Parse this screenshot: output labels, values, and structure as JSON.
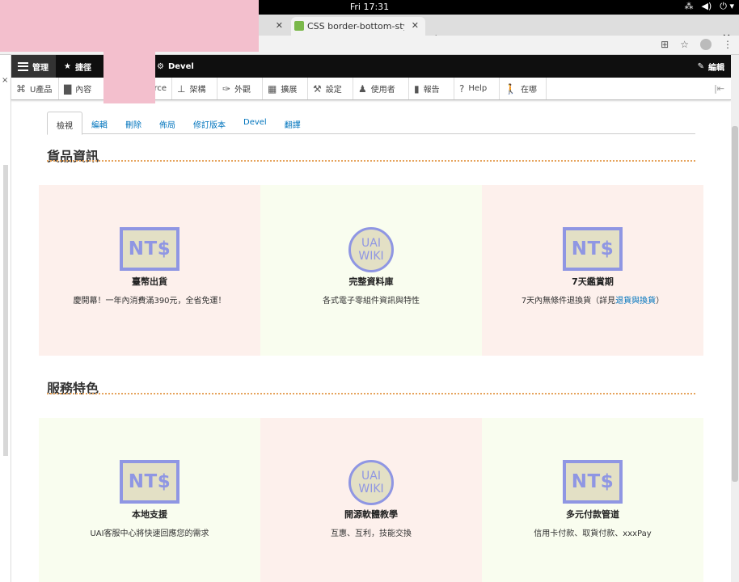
{
  "os": {
    "clock": "Fri 17:31"
  },
  "browser": {
    "tabs": [
      {
        "label": ""
      },
      {
        "label": "CSS border-bottom-style"
      }
    ],
    "new_tab": "+",
    "close": "✕"
  },
  "toolbar": {
    "manage": "管理",
    "shortcuts": "捷徑",
    "devel": "Devel",
    "edit": "編輯"
  },
  "tray": {
    "items": [
      {
        "label": "U產品",
        "icon": "gift-icon"
      },
      {
        "label": "內容",
        "icon": "page-icon"
      },
      {
        "label": "rce",
        "icon": "commerce-icon"
      },
      {
        "label": "架構",
        "icon": "sitemap-icon"
      },
      {
        "label": "外觀",
        "icon": "brush-icon"
      },
      {
        "label": "擴展",
        "icon": "puzzle-icon"
      },
      {
        "label": "設定",
        "icon": "wrench-icon"
      },
      {
        "label": "使用者",
        "icon": "people-icon"
      },
      {
        "label": "報告",
        "icon": "bar-chart-icon"
      },
      {
        "label": "Help",
        "icon": "help-icon"
      },
      {
        "label": "在哪",
        "icon": "walking-icon"
      }
    ]
  },
  "content_tabs": [
    "檢視",
    "編輯",
    "刪除",
    "佈局",
    "修訂版本",
    "Devel",
    "翻譯"
  ],
  "sections": [
    {
      "heading": "貨品資訊",
      "cards": [
        {
          "icon": "ntd",
          "title": "臺幣出貨",
          "desc": "慶開幕！一年內消費滿390元，全省免運！",
          "desc_link": "",
          "desc_tail": ""
        },
        {
          "icon": "wiki",
          "title": "完整資料庫",
          "desc": "各式電子零組件資訊與特性",
          "desc_link": "",
          "desc_tail": ""
        },
        {
          "icon": "ntd",
          "title": "7天鑑賞期",
          "desc": "7天內無條件退換貨（詳見",
          "desc_link": "退貨與換貨",
          "desc_tail": "）"
        }
      ]
    },
    {
      "heading": "服務特色",
      "cards": [
        {
          "icon": "ntd",
          "title": "本地支援",
          "desc": "UAI客服中心將快速回應您的需求",
          "desc_link": "",
          "desc_tail": ""
        },
        {
          "icon": "wiki",
          "title": "開源軟體教學",
          "desc": "互惠、互利，技能交換",
          "desc_link": "",
          "desc_tail": ""
        },
        {
          "icon": "ntd",
          "title": "多元付款管道",
          "desc": "信用卡付款、取貨付款、xxxPay",
          "desc_link": "",
          "desc_tail": ""
        }
      ]
    }
  ],
  "icons": {
    "ntd_text": "NT$",
    "wiki_line1": "UAI",
    "wiki_line2": "WIKI"
  },
  "colors": {
    "accent_icon": "#8f96e3",
    "dotted_rule": "#e6a35c",
    "link": "#0074bd"
  }
}
